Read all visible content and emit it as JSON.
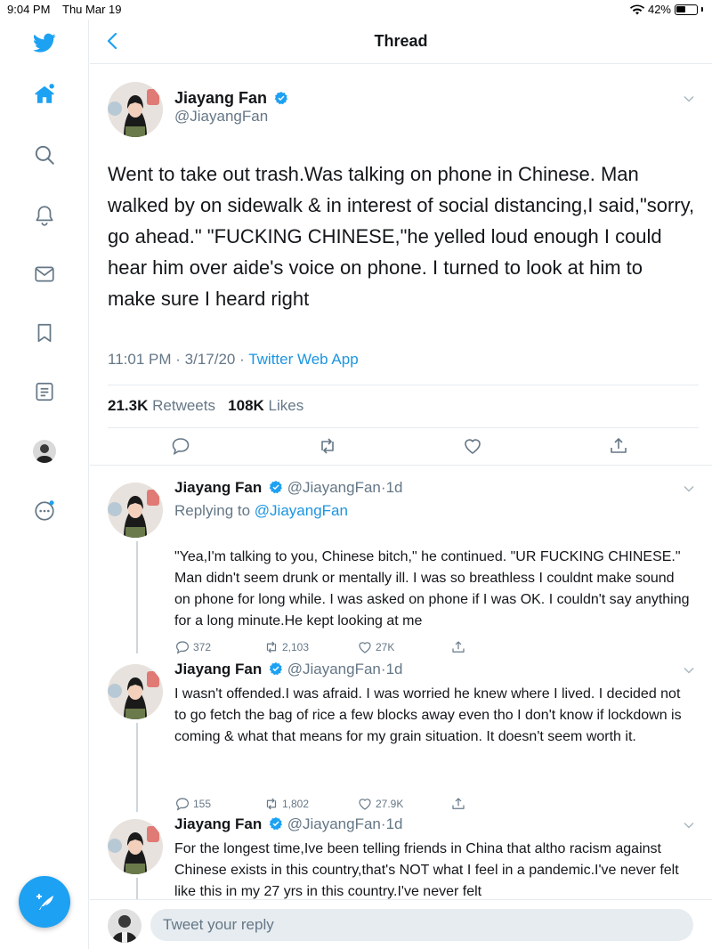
{
  "status_bar": {
    "time": "9:04 PM",
    "date": "Thu Mar 19",
    "battery": "42%",
    "battery_level": 0.42
  },
  "header": {
    "title": "Thread"
  },
  "sidebar": {
    "items": [
      "twitter-logo-icon",
      "home-icon",
      "search-icon",
      "notifications-icon",
      "messages-icon",
      "bookmarks-icon",
      "lists-icon",
      "profile-avatar",
      "more-icon"
    ]
  },
  "main_tweet": {
    "name": "Jiayang Fan",
    "handle": "@JiayangFan",
    "text": "Went to take out trash.Was talking on phone in Chinese. Man walked by on sidewalk & in interest of social distancing,I said,\"sorry, go ahead.\" \"FUCKING CHINESE,\"he yelled loud enough I could hear him over aide's voice on phone. I turned to look at him to make sure I heard right",
    "time": "11:01 PM",
    "date": "3/17/20",
    "app": "Twitter Web App",
    "retweets": "21.3K",
    "retweets_label": "Retweets",
    "likes": "108K",
    "likes_label": "Likes"
  },
  "replies": [
    {
      "name": "Jiayang Fan",
      "handle": "@JiayangFan",
      "age": "1d",
      "replying_prefix": "Replying to",
      "replying_to": "@JiayangFan",
      "text": "\"Yea,I'm talking to you, Chinese bitch,\" he continued. \"UR  FUCKING CHINESE.\" Man didn't seem drunk or mentally ill. I was so breathless I couldnt make sound on phone for long while. I was asked on phone if I was OK. I couldn't say anything for a long minute.He kept looking at me",
      "replies": "372",
      "retweets": "2,103",
      "likes": "27K"
    },
    {
      "name": "Jiayang Fan",
      "handle": "@JiayangFan",
      "age": "1d",
      "text": "I wasn't offended.I was afraid. I was worried he knew where I lived. I decided not to go fetch the bag of rice a few blocks away even tho I don't know if lockdown is coming & what that means for my grain situation. It doesn't seem worth it.",
      "replies": "155",
      "retweets": "1,802",
      "likes": "27.9K"
    },
    {
      "name": "Jiayang Fan",
      "handle": "@JiayangFan",
      "age": "1d",
      "text": "For the longest time,Ive been telling friends in China that altho racism against Chinese exists in this country,that's NOT what I feel in a pandemic.I've never felt like this in my 27 yrs in this country.I've never felt"
    }
  ],
  "reply_bar": {
    "placeholder": "Tweet your reply"
  },
  "colors": {
    "accent": "#1da1f2",
    "link": "#1b95e0",
    "muted": "#657786",
    "border": "#e6ecf0"
  }
}
